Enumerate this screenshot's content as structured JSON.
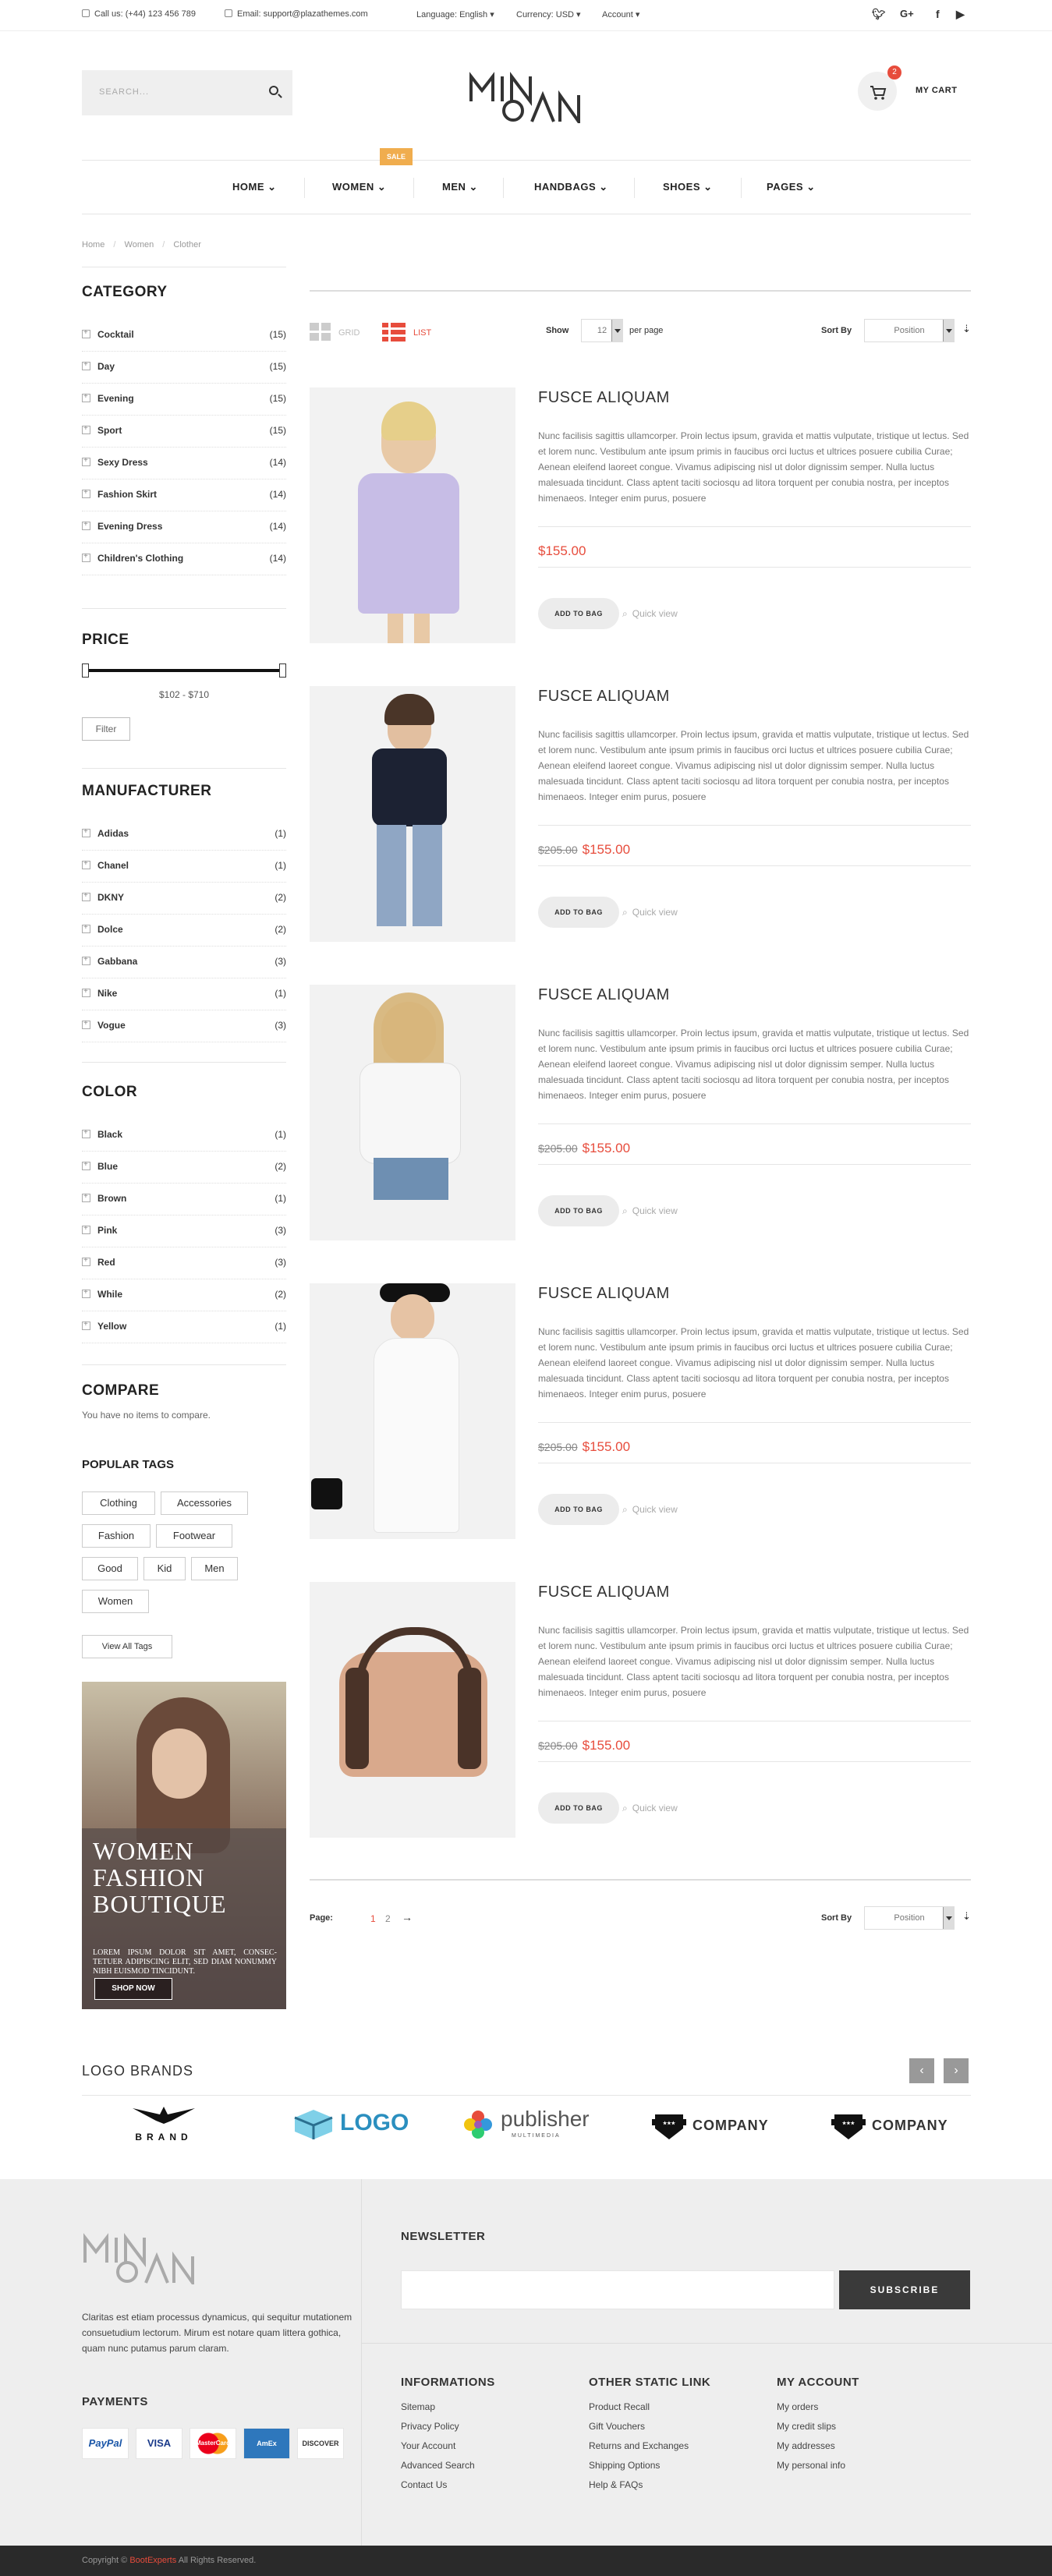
{
  "topbar": {
    "phone": "Call us: (+44) 123 456 789",
    "email": "Email: support@plazathemes.com",
    "language_label": "Language:",
    "language_value": "English",
    "currency_label": "Currency:",
    "currency_value": "USD",
    "account": "Account"
  },
  "header": {
    "search_placeholder": "SEARCH...",
    "cart_count": "2",
    "cart_label": "MY CART"
  },
  "nav": {
    "items": [
      "HOME",
      "WOMEN",
      "MEN",
      "HANDBAGS",
      "SHOES",
      "PAGES"
    ],
    "sale_badge": "SALE"
  },
  "breadcrumb": {
    "home": "Home",
    "women": "Women",
    "current": "Clother"
  },
  "sidebar": {
    "category_title": "CATEGORY",
    "categories": [
      {
        "label": "Cocktail",
        "count": "(15)"
      },
      {
        "label": "Day",
        "count": "(15)"
      },
      {
        "label": "Evening",
        "count": "(15)"
      },
      {
        "label": "Sport",
        "count": "(15)"
      },
      {
        "label": "Sexy Dress",
        "count": "(14)"
      },
      {
        "label": "Fashion Skirt",
        "count": "(14)"
      },
      {
        "label": "Evening Dress",
        "count": "(14)"
      },
      {
        "label": "Children's Clothing",
        "count": "(14)"
      }
    ],
    "price_title": "PRICE",
    "price_range": "$102 - $710",
    "filter_label": "Filter",
    "manufacturer_title": "MANUFACTURER",
    "manufacturers": [
      {
        "label": "Adidas",
        "count": "(1)"
      },
      {
        "label": "Chanel",
        "count": "(1)"
      },
      {
        "label": "DKNY",
        "count": "(2)"
      },
      {
        "label": "Dolce",
        "count": "(2)"
      },
      {
        "label": "Gabbana",
        "count": "(3)"
      },
      {
        "label": "Nike",
        "count": "(1)"
      },
      {
        "label": "Vogue",
        "count": "(3)"
      }
    ],
    "color_title": "COLOR",
    "colors": [
      {
        "label": "Black",
        "count": "(1)"
      },
      {
        "label": "Blue",
        "count": "(2)"
      },
      {
        "label": "Brown",
        "count": "(1)"
      },
      {
        "label": "Pink",
        "count": "(3)"
      },
      {
        "label": "Red",
        "count": "(3)"
      },
      {
        "label": "While",
        "count": "(2)"
      },
      {
        "label": "Yellow",
        "count": "(1)"
      }
    ],
    "compare_title": "COMPARE",
    "compare_text": "You have no items to compare.",
    "tags_title": "POPULAR TAGS",
    "tags": [
      "Clothing",
      "Accessories",
      "Fashion",
      "Footwear",
      "Good",
      "Kid",
      "Men",
      "Women"
    ],
    "view_all_tags": "View All Tags",
    "banner": {
      "line1": "WOMEN",
      "line2": "FASHION",
      "line3": "BOUTIQUE",
      "text": "LOREM IPSUM DOLOR SIT AMET, CONSEC-TETUER ADIPISCING ELIT, SED DIAM NONUMMY NIBH EUISMOD TINCIDUNT.",
      "button": "SHOP NOW"
    }
  },
  "toolbar": {
    "grid": "GRID",
    "list": "LIST",
    "show_label": "Show",
    "show_value": "12",
    "per_page": "per page",
    "sort_label": "Sort By",
    "sort_value": "Position",
    "page_label": "Page:",
    "pages": [
      "1",
      "2"
    ]
  },
  "products": [
    {
      "title": "FUSCE ALIQUAM",
      "old_price": "",
      "price": "$155.00"
    },
    {
      "title": "FUSCE ALIQUAM",
      "old_price": "$205.00",
      "price": "$155.00"
    },
    {
      "title": "FUSCE ALIQUAM",
      "old_price": "$205.00",
      "price": "$155.00"
    },
    {
      "title": "FUSCE ALIQUAM",
      "old_price": "$205.00",
      "price": "$155.00"
    },
    {
      "title": "FUSCE ALIQUAM",
      "old_price": "$205.00",
      "price": "$155.00"
    }
  ],
  "product_desc": "Nunc facilisis sagittis ullamcorper. Proin lectus ipsum, gravida et mattis vulputate, tristique ut lectus. Sed et lorem nunc. Vestibulum ante ipsum primis in faucibus orci luctus et ultrices posuere cubilia Curae; Aenean eleifend laoreet congue. Vivamus adipiscing nisl ut dolor dignissim semper. Nulla luctus malesuada tincidunt. Class aptent taciti sociosqu ad litora torquent per conubia nostra, per inceptos himenaeos. Integer enim purus, posuere",
  "product_actions": {
    "add_to_bag": "ADD TO BAG",
    "quick_view": "Quick view"
  },
  "brands": {
    "title": "LOGO BRANDS",
    "items": [
      "BRAND",
      "LOGO",
      "publisher",
      "COMPANY",
      "COMPANY"
    ],
    "publisher_sub": "MULTIMEDIA"
  },
  "footer": {
    "about": "Claritas est etiam processus dynamicus, qui sequitur mutationem consuetudium lectorum. Mirum est notare quam littera gothica, quam nunc putamus parum claram.",
    "payments_title": "PAYMENTS",
    "payments": [
      "PayPal",
      "VISA",
      "MasterCard",
      "AmEx",
      "DISCOVER"
    ],
    "newsletter_title": "NEWSLETTER",
    "subscribe": "SUBSCRIBE",
    "info_title": "INFORMATIONS",
    "info_links": [
      "Sitemap",
      "Privacy Policy",
      "Your Account",
      "Advanced Search",
      "Contact Us"
    ],
    "static_title": "OTHER STATIC LINK",
    "static_links": [
      "Product Recall",
      "Gift Vouchers",
      "Returns and Exchanges",
      "Shipping Options",
      "Help & FAQs"
    ],
    "account_title": "MY ACCOUNT",
    "account_links": [
      "My orders",
      "My credit slips",
      "My addresses",
      "My personal info"
    ],
    "copyright_pre": "Copyright ©",
    "copyright_brand": "BootExperts",
    "copyright_post": "All Rights Reserved."
  },
  "colors": {
    "accent": "#e74c3c",
    "sale": "#f0ad4e",
    "dark": "#3a3a3a"
  }
}
